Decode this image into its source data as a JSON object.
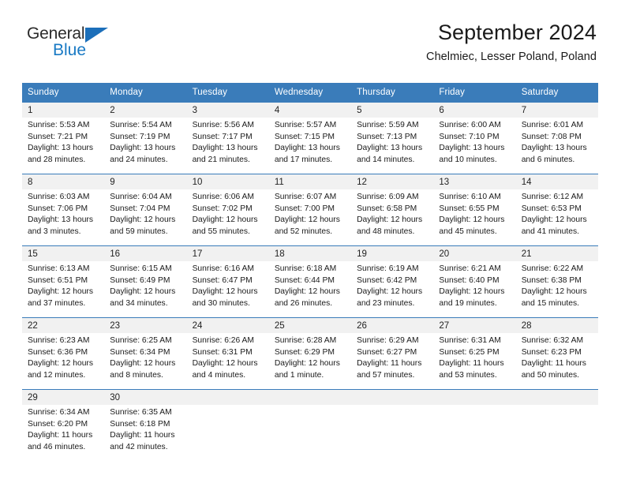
{
  "brand": {
    "name_part1": "General",
    "name_part2": "Blue",
    "logo_icon": "triangle-icon"
  },
  "header": {
    "title": "September 2024",
    "subtitle": "Chelmiec, Lesser Poland, Poland"
  },
  "colors": {
    "header_blue": "#3a7cba",
    "brand_blue": "#1879c4",
    "daynum_band": "#f1f1f1"
  },
  "calendar": {
    "weekday_headers": [
      "Sunday",
      "Monday",
      "Tuesday",
      "Wednesday",
      "Thursday",
      "Friday",
      "Saturday"
    ],
    "weeks": [
      [
        {
          "day": "1",
          "sunrise": "Sunrise: 5:53 AM",
          "sunset": "Sunset: 7:21 PM",
          "daylight1": "Daylight: 13 hours",
          "daylight2": "and 28 minutes."
        },
        {
          "day": "2",
          "sunrise": "Sunrise: 5:54 AM",
          "sunset": "Sunset: 7:19 PM",
          "daylight1": "Daylight: 13 hours",
          "daylight2": "and 24 minutes."
        },
        {
          "day": "3",
          "sunrise": "Sunrise: 5:56 AM",
          "sunset": "Sunset: 7:17 PM",
          "daylight1": "Daylight: 13 hours",
          "daylight2": "and 21 minutes."
        },
        {
          "day": "4",
          "sunrise": "Sunrise: 5:57 AM",
          "sunset": "Sunset: 7:15 PM",
          "daylight1": "Daylight: 13 hours",
          "daylight2": "and 17 minutes."
        },
        {
          "day": "5",
          "sunrise": "Sunrise: 5:59 AM",
          "sunset": "Sunset: 7:13 PM",
          "daylight1": "Daylight: 13 hours",
          "daylight2": "and 14 minutes."
        },
        {
          "day": "6",
          "sunrise": "Sunrise: 6:00 AM",
          "sunset": "Sunset: 7:10 PM",
          "daylight1": "Daylight: 13 hours",
          "daylight2": "and 10 minutes."
        },
        {
          "day": "7",
          "sunrise": "Sunrise: 6:01 AM",
          "sunset": "Sunset: 7:08 PM",
          "daylight1": "Daylight: 13 hours",
          "daylight2": "and 6 minutes."
        }
      ],
      [
        {
          "day": "8",
          "sunrise": "Sunrise: 6:03 AM",
          "sunset": "Sunset: 7:06 PM",
          "daylight1": "Daylight: 13 hours",
          "daylight2": "and 3 minutes."
        },
        {
          "day": "9",
          "sunrise": "Sunrise: 6:04 AM",
          "sunset": "Sunset: 7:04 PM",
          "daylight1": "Daylight: 12 hours",
          "daylight2": "and 59 minutes."
        },
        {
          "day": "10",
          "sunrise": "Sunrise: 6:06 AM",
          "sunset": "Sunset: 7:02 PM",
          "daylight1": "Daylight: 12 hours",
          "daylight2": "and 55 minutes."
        },
        {
          "day": "11",
          "sunrise": "Sunrise: 6:07 AM",
          "sunset": "Sunset: 7:00 PM",
          "daylight1": "Daylight: 12 hours",
          "daylight2": "and 52 minutes."
        },
        {
          "day": "12",
          "sunrise": "Sunrise: 6:09 AM",
          "sunset": "Sunset: 6:58 PM",
          "daylight1": "Daylight: 12 hours",
          "daylight2": "and 48 minutes."
        },
        {
          "day": "13",
          "sunrise": "Sunrise: 6:10 AM",
          "sunset": "Sunset: 6:55 PM",
          "daylight1": "Daylight: 12 hours",
          "daylight2": "and 45 minutes."
        },
        {
          "day": "14",
          "sunrise": "Sunrise: 6:12 AM",
          "sunset": "Sunset: 6:53 PM",
          "daylight1": "Daylight: 12 hours",
          "daylight2": "and 41 minutes."
        }
      ],
      [
        {
          "day": "15",
          "sunrise": "Sunrise: 6:13 AM",
          "sunset": "Sunset: 6:51 PM",
          "daylight1": "Daylight: 12 hours",
          "daylight2": "and 37 minutes."
        },
        {
          "day": "16",
          "sunrise": "Sunrise: 6:15 AM",
          "sunset": "Sunset: 6:49 PM",
          "daylight1": "Daylight: 12 hours",
          "daylight2": "and 34 minutes."
        },
        {
          "day": "17",
          "sunrise": "Sunrise: 6:16 AM",
          "sunset": "Sunset: 6:47 PM",
          "daylight1": "Daylight: 12 hours",
          "daylight2": "and 30 minutes."
        },
        {
          "day": "18",
          "sunrise": "Sunrise: 6:18 AM",
          "sunset": "Sunset: 6:44 PM",
          "daylight1": "Daylight: 12 hours",
          "daylight2": "and 26 minutes."
        },
        {
          "day": "19",
          "sunrise": "Sunrise: 6:19 AM",
          "sunset": "Sunset: 6:42 PM",
          "daylight1": "Daylight: 12 hours",
          "daylight2": "and 23 minutes."
        },
        {
          "day": "20",
          "sunrise": "Sunrise: 6:21 AM",
          "sunset": "Sunset: 6:40 PM",
          "daylight1": "Daylight: 12 hours",
          "daylight2": "and 19 minutes."
        },
        {
          "day": "21",
          "sunrise": "Sunrise: 6:22 AM",
          "sunset": "Sunset: 6:38 PM",
          "daylight1": "Daylight: 12 hours",
          "daylight2": "and 15 minutes."
        }
      ],
      [
        {
          "day": "22",
          "sunrise": "Sunrise: 6:23 AM",
          "sunset": "Sunset: 6:36 PM",
          "daylight1": "Daylight: 12 hours",
          "daylight2": "and 12 minutes."
        },
        {
          "day": "23",
          "sunrise": "Sunrise: 6:25 AM",
          "sunset": "Sunset: 6:34 PM",
          "daylight1": "Daylight: 12 hours",
          "daylight2": "and 8 minutes."
        },
        {
          "day": "24",
          "sunrise": "Sunrise: 6:26 AM",
          "sunset": "Sunset: 6:31 PM",
          "daylight1": "Daylight: 12 hours",
          "daylight2": "and 4 minutes."
        },
        {
          "day": "25",
          "sunrise": "Sunrise: 6:28 AM",
          "sunset": "Sunset: 6:29 PM",
          "daylight1": "Daylight: 12 hours",
          "daylight2": "and 1 minute."
        },
        {
          "day": "26",
          "sunrise": "Sunrise: 6:29 AM",
          "sunset": "Sunset: 6:27 PM",
          "daylight1": "Daylight: 11 hours",
          "daylight2": "and 57 minutes."
        },
        {
          "day": "27",
          "sunrise": "Sunrise: 6:31 AM",
          "sunset": "Sunset: 6:25 PM",
          "daylight1": "Daylight: 11 hours",
          "daylight2": "and 53 minutes."
        },
        {
          "day": "28",
          "sunrise": "Sunrise: 6:32 AM",
          "sunset": "Sunset: 6:23 PM",
          "daylight1": "Daylight: 11 hours",
          "daylight2": "and 50 minutes."
        }
      ],
      [
        {
          "day": "29",
          "sunrise": "Sunrise: 6:34 AM",
          "sunset": "Sunset: 6:20 PM",
          "daylight1": "Daylight: 11 hours",
          "daylight2": "and 46 minutes."
        },
        {
          "day": "30",
          "sunrise": "Sunrise: 6:35 AM",
          "sunset": "Sunset: 6:18 PM",
          "daylight1": "Daylight: 11 hours",
          "daylight2": "and 42 minutes."
        },
        {
          "day": "",
          "sunrise": "",
          "sunset": "",
          "daylight1": "",
          "daylight2": ""
        },
        {
          "day": "",
          "sunrise": "",
          "sunset": "",
          "daylight1": "",
          "daylight2": ""
        },
        {
          "day": "",
          "sunrise": "",
          "sunset": "",
          "daylight1": "",
          "daylight2": ""
        },
        {
          "day": "",
          "sunrise": "",
          "sunset": "",
          "daylight1": "",
          "daylight2": ""
        },
        {
          "day": "",
          "sunrise": "",
          "sunset": "",
          "daylight1": "",
          "daylight2": ""
        }
      ]
    ]
  }
}
